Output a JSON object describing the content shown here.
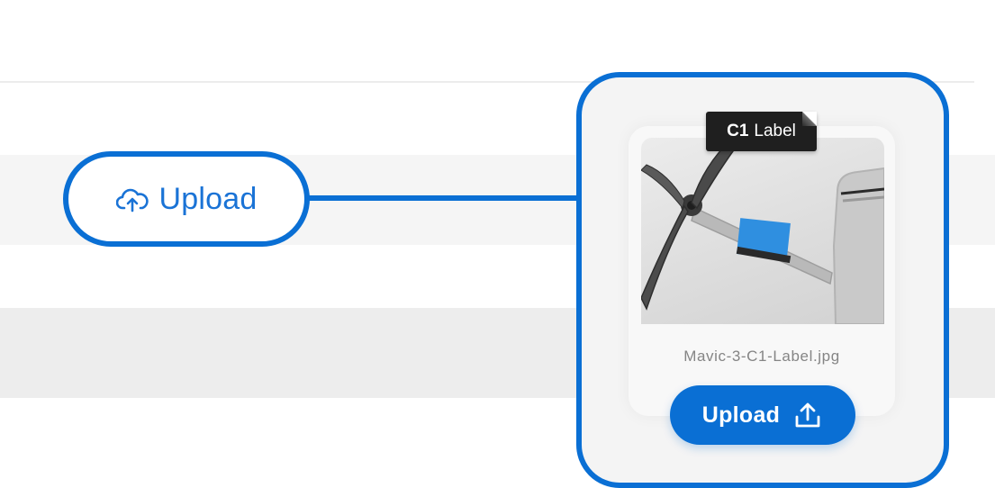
{
  "toolbar": {
    "upload_label": "Upload",
    "upload_icon": "cloud-upload-icon"
  },
  "preview_card": {
    "tag": {
      "bold": "C1",
      "text": "Label"
    },
    "image_subject": "drone arm with propeller and C1 label",
    "filename": "Mavic-3-C1-Label.jpg",
    "upload_label": "Upload",
    "upload_icon": "upload-arrow-icon"
  },
  "colors": {
    "accent": "#0a6fd4",
    "link_text": "#1a73d6",
    "filename_text": "#858585",
    "band_light": "#f5f5f5",
    "band_gray": "#ededed"
  }
}
